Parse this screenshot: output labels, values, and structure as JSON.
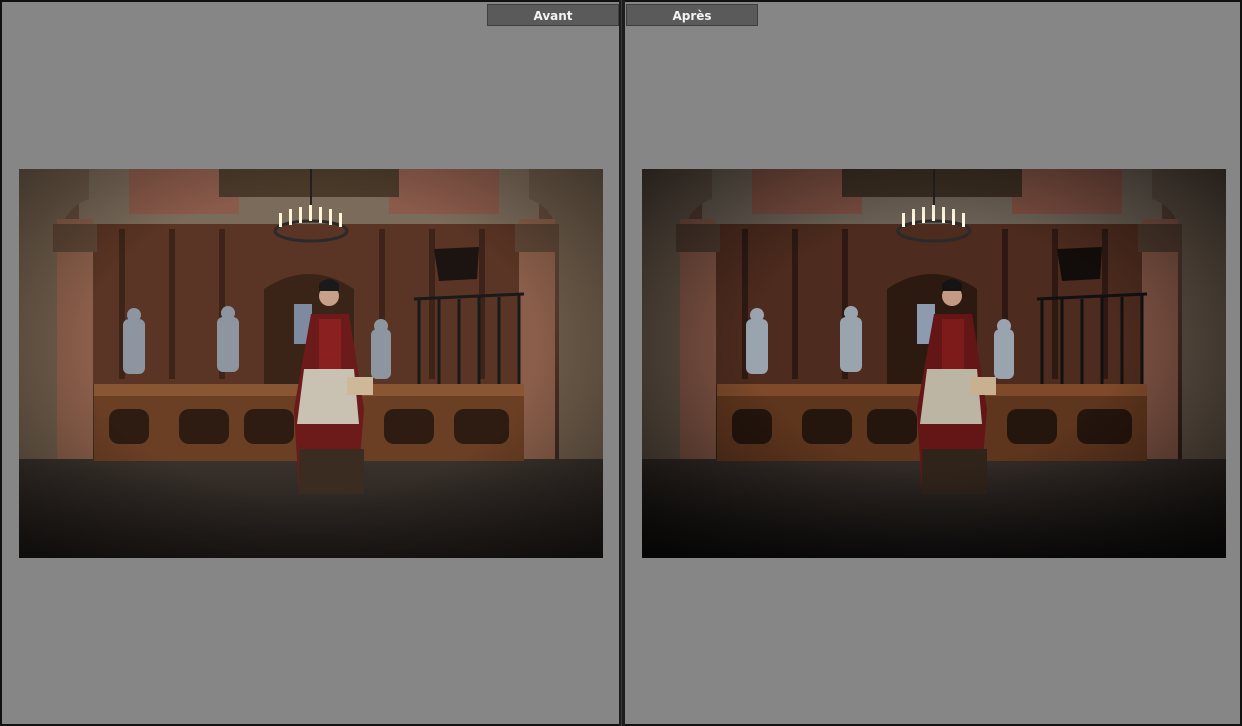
{
  "labels": {
    "before": "Avant",
    "after": "Après"
  },
  "colors": {
    "pane_background": "#868686",
    "label_background": "#5a5a5a",
    "label_text": "#f2f2f2",
    "divider": "#1c1c1c"
  },
  "panes": [
    {
      "id": "before",
      "image_description_icon": "photo-castle-hall-icon"
    },
    {
      "id": "after",
      "image_description_icon": "photo-castle-hall-icon"
    }
  ]
}
